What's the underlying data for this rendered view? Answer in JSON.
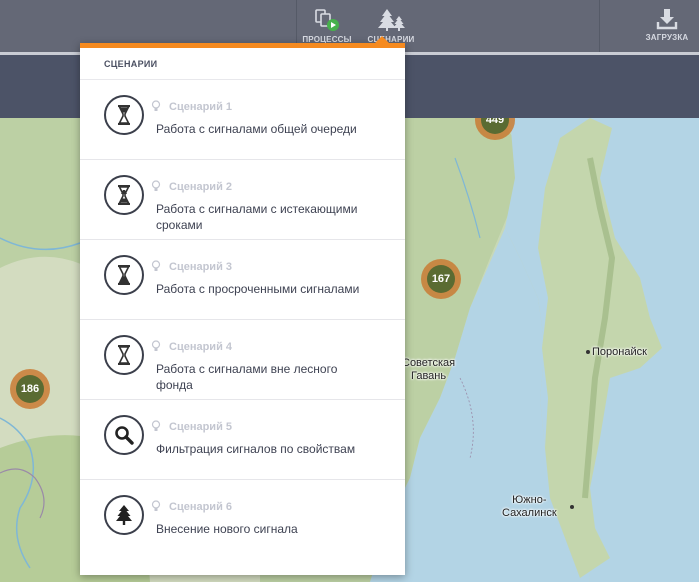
{
  "nav": {
    "tabs": [
      {
        "label": "ПРОЦЕССЫ",
        "icon": "processes-icon"
      },
      {
        "label": "СЦЕНАРИИ",
        "icon": "forest-icon"
      },
      {
        "label": "ЗАГРУЗКА",
        "icon": "download-icon"
      }
    ]
  },
  "dropdown": {
    "header": "СЦЕНАРИИ",
    "items": [
      {
        "number": "Сценарий 1",
        "title": "Работа с сигналами общей очереди",
        "icon": "hourglass-top-icon"
      },
      {
        "number": "Сценарий 2",
        "title": "Работа с сигналами с истекающими сроками",
        "icon": "hourglass-bottom-icon"
      },
      {
        "number": "Сценарий 3",
        "title": "Работа с просроченными сигналами",
        "icon": "hourglass-full-icon"
      },
      {
        "number": "Сценарий 4",
        "title": "Работа с сигналами вне лесного фонда",
        "icon": "hourglass-empty-icon"
      },
      {
        "number": "Сценарий 5",
        "title": "Фильтрация сигналов по свойствам",
        "icon": "search-icon"
      },
      {
        "number": "Сценарий 6",
        "title": "Внесение нового сигнала",
        "icon": "tree-icon"
      }
    ]
  },
  "map": {
    "clusters": [
      {
        "count": "449"
      },
      {
        "count": "167"
      },
      {
        "count": "186"
      }
    ],
    "cities": [
      {
        "name": "Советская\nГавань"
      },
      {
        "name": "Поронайск"
      },
      {
        "name": "Южно-\nСахалинск"
      }
    ]
  },
  "colors": {
    "topbar": "#646876",
    "subbar": "#4c5367",
    "accent": "#f58a1f",
    "cluster_ring": "#c97b34",
    "cluster_core": "#5a6b32"
  }
}
